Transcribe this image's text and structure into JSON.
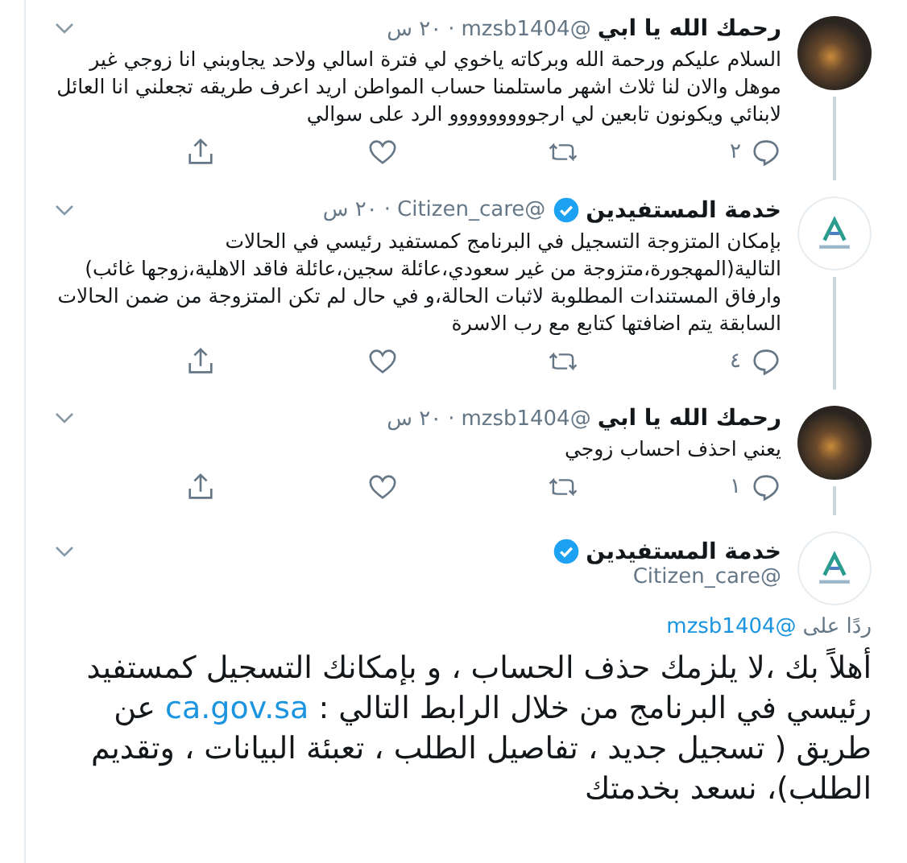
{
  "tweets": [
    {
      "kind": "photo",
      "name": "رحمك الله يا ابي",
      "verified": false,
      "handle": "@mzsb1404",
      "separator": "·",
      "time": "٢٠ س",
      "text": "السلام عليكم ورحمة  الله وبركاته  ياخوي لي فترة اسالي ولاحد يجاوبني انا زوجي غير موهل والان لنا ثلاث اشهر ماستلمنا حساب المواطن اريد اعرف طريقه تجعلني انا العائل لابنائي ويكونون تابعين لي ارجووووووووو الرد على سوالي",
      "replies": "٢"
    },
    {
      "kind": "logo",
      "name": "خدمة المستفيدين",
      "verified": true,
      "handle": "@Citizen_care",
      "separator": "·",
      "time": "٢٠ س",
      "text": "بإمكان المتزوجة التسجيل في البرنامج كمستفيد رئيسي في الحالات التالية(المهجورة،متزوجة من غير سعودي،عائلة سجين،عائلة فاقد الاهلية،زوجها غائب) وارفاق المستندات المطلوبة لاثبات الحالة،و في حال لم تكن المتزوجة من ضمن الحالات السابقة يتم اضافتها كتابع مع رب الاسرة",
      "replies": "٤"
    },
    {
      "kind": "photo",
      "name": "رحمك الله يا ابي",
      "verified": false,
      "handle": "@mzsb1404",
      "separator": "·",
      "time": "٢٠ س",
      "text": "يعني احذف احساب زوجي",
      "replies": "١"
    }
  ],
  "main": {
    "kind": "logo",
    "name": "خدمة المستفيدين",
    "verified": true,
    "handle": "@Citizen_care",
    "replying_label": "ردًا على",
    "replying_to": "@mzsb1404",
    "text_before": "أهلاً بك ،لا يلزمك حذف الحساب ، و بإمكانك التسجيل كمستفيد رئيسي  في البرنامج من خلال الرابط التالي : ",
    "link": "ca.gov.sa",
    "text_after": " عن طريق ( تسجيل جديد ، تفاصيل الطلب ، تعبئة البيانات ، وتقديم الطلب)، نسعد بخدمتك"
  }
}
